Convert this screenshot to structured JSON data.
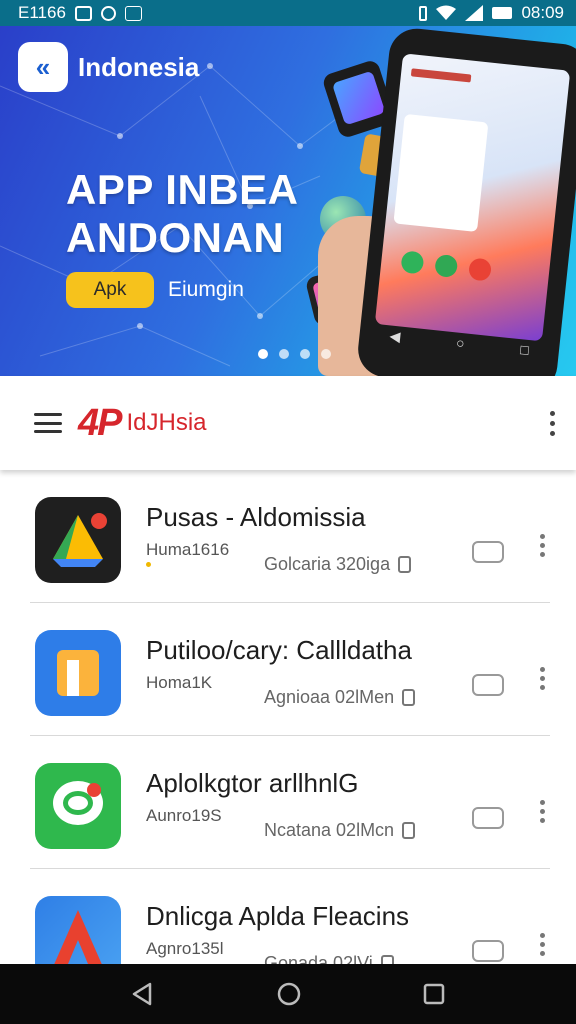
{
  "status_bar": {
    "left_text": "E1166",
    "time": "08:09",
    "left_icons": [
      "notification-box-icon",
      "circle-app-icon",
      "image-icon"
    ],
    "right_icons": [
      "vibrate-icon",
      "wifi-icon",
      "signal-icon",
      "battery-icon"
    ]
  },
  "banner": {
    "brand": "Indonesia",
    "title_line1": "APP INBEA",
    "title_line2": "ANDONAN",
    "button_label": "Apk",
    "link_label": "Eiumgin",
    "page_count": 4,
    "active_page": 1
  },
  "toolbar": {
    "logo_text": "4P",
    "name": "IdJHsia"
  },
  "apps": [
    {
      "title": "Pusas - Aldomissia",
      "subtitle": "Huma1616",
      "meta": "Golcaria 320iga",
      "icon": "drive-triangle-icon"
    },
    {
      "title": "Putiloo/cary: Callldatha",
      "subtitle": "Homa1K",
      "meta": "Agnioaa 02lMen",
      "icon": "orange-square-icon"
    },
    {
      "title": "Aplolkgtor arllhnlG",
      "subtitle": "Aunro19S",
      "meta": "Ncatana 02lMcn",
      "icon": "chat-bubble-icon"
    },
    {
      "title": "Dnlicga Aplda Fleacins",
      "subtitle": "Agnro135l",
      "meta": "Gonada 02lVi",
      "icon": "red-a-icon"
    }
  ],
  "colors": {
    "status_bar": "#0a6e8a",
    "banner_start": "#2a3fc9",
    "banner_end": "#27c9f0",
    "accent_button": "#f6c21c",
    "logo_red": "#d6262c",
    "nav_bar": "#0a0a0a"
  }
}
